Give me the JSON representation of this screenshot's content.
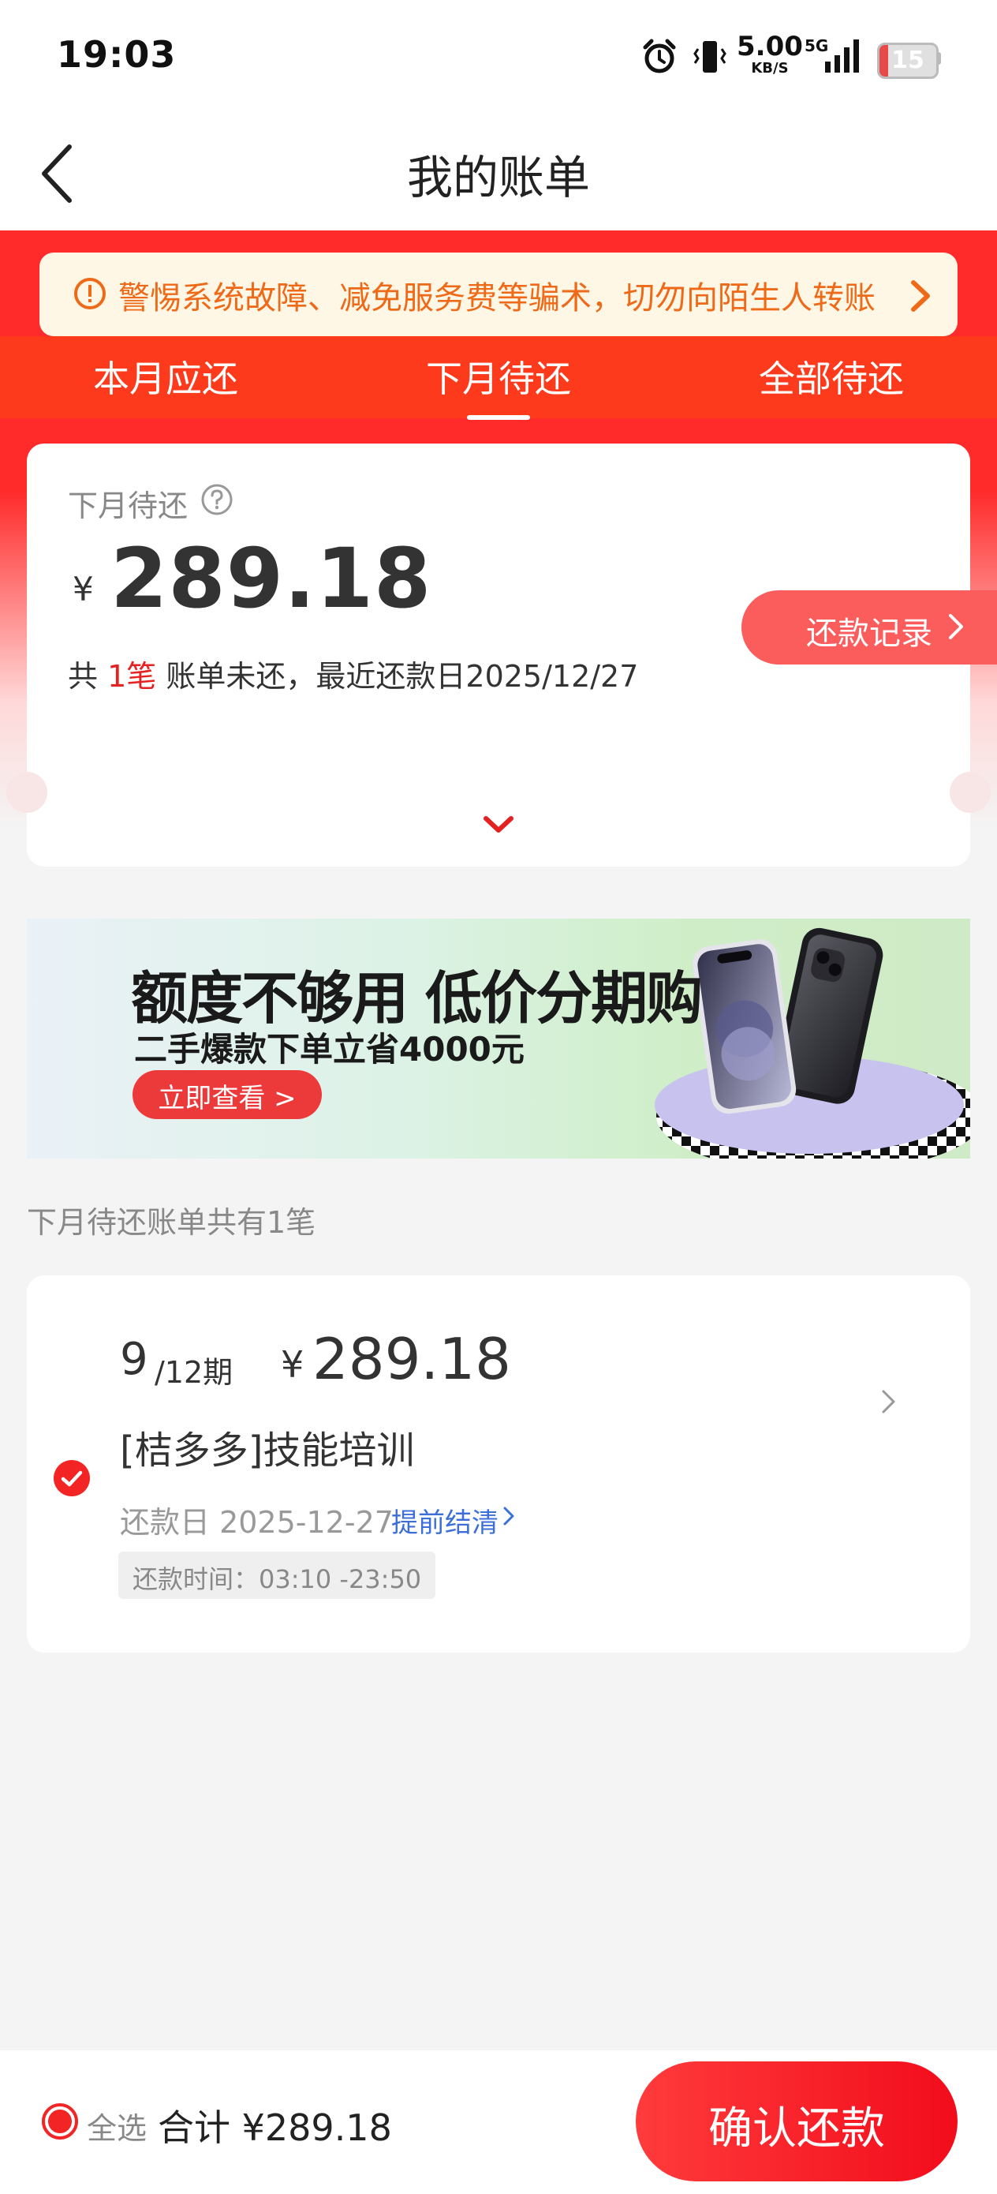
{
  "status_bar": {
    "time": "19:03",
    "net_speed_value": "5.00",
    "net_speed_unit": "KB/S",
    "network": "5G",
    "battery": "15",
    "battery_level": 0.15,
    "icons": [
      "alarm-icon",
      "vibrate-icon",
      "signal-icon",
      "battery-icon"
    ]
  },
  "nav": {
    "title": "我的账单"
  },
  "notice": {
    "text": "警惕系统故障、减免服务费等骗术，切勿向陌生人转账"
  },
  "tabs": [
    {
      "label": "本月应还",
      "active": false
    },
    {
      "label": "下月待还",
      "active": true
    },
    {
      "label": "全部待还",
      "active": false
    }
  ],
  "summary": {
    "label": "下月待还",
    "currency": "¥",
    "amount": "289.18",
    "desc_prefix": "共",
    "desc_count": "1笔",
    "desc_suffix": "账单未还，最近还款日2025/12/27",
    "record_button": "还款记录"
  },
  "banner": {
    "headline": "额度不够用 低价分期购",
    "subtitle": "二手爆款下单立省4000元",
    "button": "立即查看 >"
  },
  "list": {
    "caption": "下月待还账单共有1笔",
    "items": [
      {
        "period_current": "9",
        "period_total": "/12期",
        "currency": "¥",
        "amount": "289.18",
        "name": "[桔多多]技能培训",
        "due": "还款日 2025-12-27",
        "early_payoff": "提前结清",
        "time_window": "还款时间：03:10 -23:50",
        "checked": true
      }
    ]
  },
  "footer": {
    "select_all": "全选",
    "total": "合计 ¥289.18",
    "confirm": "确认还款"
  },
  "colors": {
    "brand_red": "#ff2a2a",
    "tab_bar": "#fe3a1c",
    "notice_text": "#ee6a18",
    "link_blue": "#3c6fd8"
  }
}
